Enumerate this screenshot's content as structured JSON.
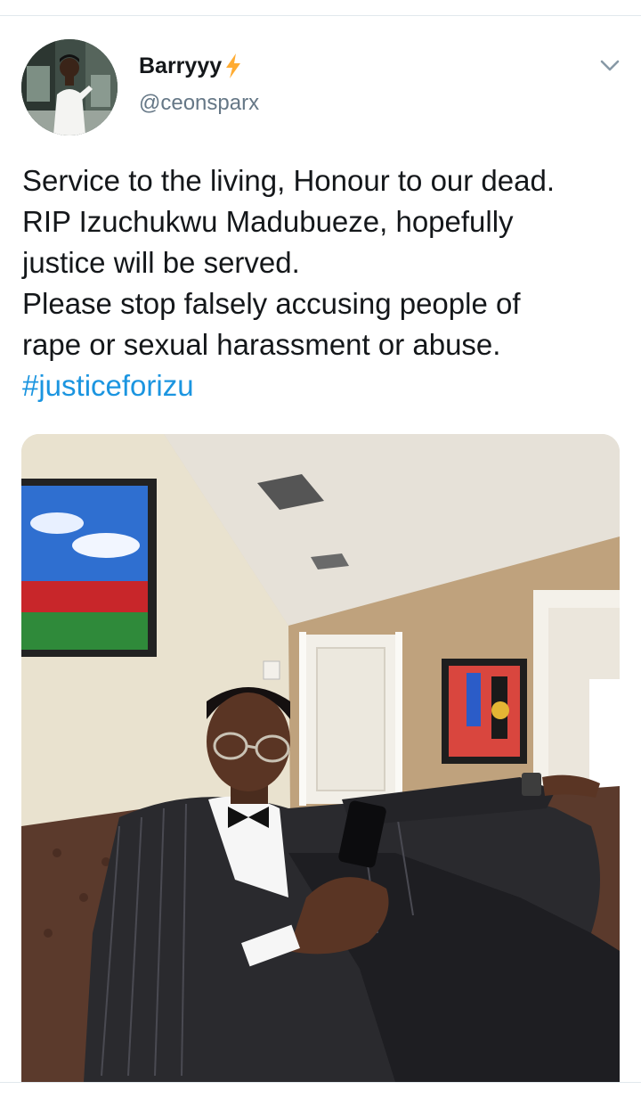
{
  "tweet": {
    "display_name": "Barryyy",
    "name_badge_icon": "lightning-bolt-icon",
    "handle": "@ceonsparx",
    "menu_icon": "chevron-down-icon",
    "text_lines": [
      "Service to the living, Honour to our dead.",
      "RIP Izuchukwu Madubueze, hopefully",
      "justice will be served.",
      "Please stop falsely accusing people of",
      "rape or sexual harassment or abuse."
    ],
    "hashtag": "#justiceforizu",
    "colors": {
      "text": "#14171a",
      "secondary": "#657786",
      "link": "#1b95e0",
      "badge": "#ffac33",
      "divider": "#e1e8ed"
    }
  }
}
